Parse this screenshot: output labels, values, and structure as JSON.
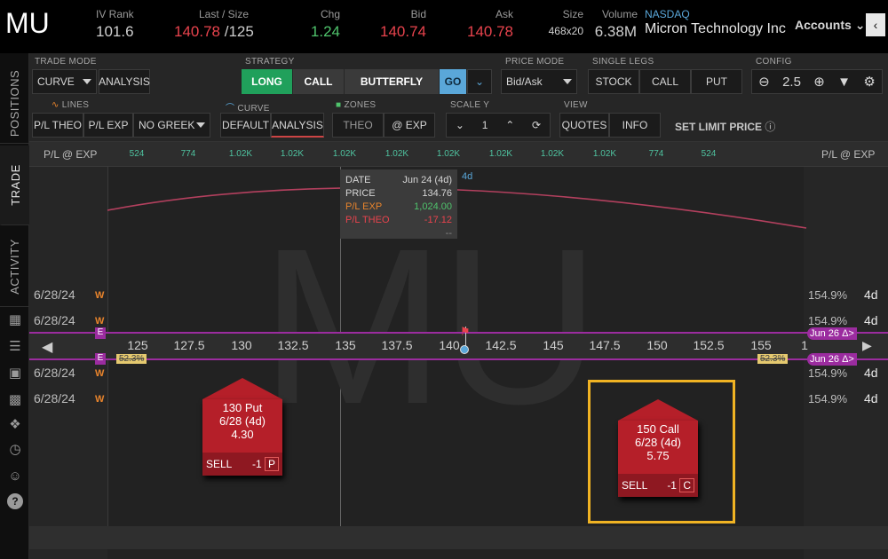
{
  "quote": {
    "symbol": "MU",
    "iv_rank_label": "IV Rank",
    "iv_rank": "101.6",
    "last_label": "Last / Size",
    "last": "140.78",
    "size": "/125",
    "chg_label": "Chg",
    "chg": "1.24",
    "bid_label": "Bid",
    "bid": "140.74",
    "ask_label": "Ask",
    "ask": "140.78",
    "size_label": "Size",
    "size_val": "468x20",
    "volume_label": "Volume",
    "volume": "6.38M",
    "exchange": "NASDAQ",
    "company": "Micron Technology Inc",
    "accounts": "Accounts"
  },
  "sidebar": {
    "positions": "POSITIONS",
    "trade": "TRADE",
    "activity": "ACTIVITY"
  },
  "toolbar": {
    "trade_mode_label": "TRADE MODE",
    "trade_mode": "CURVE",
    "analysis": "ANALYSIS",
    "strategy_label": "STRATEGY",
    "long": "LONG",
    "call": "CALL",
    "butterfly": "BUTTERFLY",
    "go": "GO",
    "price_mode_label": "PRICE MODE",
    "price_mode": "Bid/Ask",
    "single_legs_label": "SINGLE LEGS",
    "stock": "STOCK",
    "leg_call": "CALL",
    "put": "PUT",
    "config_label": "CONFIG",
    "zoom": "2.5",
    "lines_label": "LINES",
    "pl_theo": "P/L THEO",
    "pl_exp": "P/L EXP",
    "no_greek": "NO GREEK",
    "curve_label": "CURVE",
    "default": "DEFAULT",
    "curve_analysis": "ANALYSIS",
    "zones_label": "ZONES",
    "theo": "THEO",
    "at_exp": "@ EXP",
    "scale_y_label": "SCALE Y",
    "scale_y": "1",
    "view_label": "VIEW",
    "quotes": "QUOTES",
    "info": "INFO",
    "set_limit": "SET LIMIT PRICE"
  },
  "header_row": {
    "left_label": "P/L @ EXP",
    "right_label": "P/L @ EXP",
    "values": [
      "524",
      "774",
      "1.02K",
      "1.02K",
      "1.02K",
      "1.02K",
      "1.02K",
      "1.02K",
      "1.02K",
      "1.02K",
      "774",
      "524"
    ]
  },
  "tooltip": {
    "date_label": "DATE",
    "date": "Jun 24 (4d)",
    "price_label": "PRICE",
    "price": "134.76",
    "pl_exp_label": "P/L EXP",
    "pl_exp": "1,024.00",
    "pl_theo_label": "P/L THEO",
    "pl_theo": "-17.12",
    "dash": "--",
    "days_tag": "4d"
  },
  "watermark": "MU",
  "rows": [
    {
      "date": "6/28/24",
      "w": "W",
      "iv": "154.9%",
      "days": "4d"
    },
    {
      "date": "6/28/24",
      "w": "W",
      "iv": "154.9%",
      "days": "4d"
    },
    {
      "date": "6/28/24",
      "w": "W",
      "iv": "154.9%",
      "days": "4d"
    },
    {
      "date": "6/28/24",
      "w": "W",
      "iv": "154.9%",
      "days": "4d"
    }
  ],
  "strikes": [
    "125",
    "127.5",
    "130",
    "132.5",
    "135",
    "137.5",
    "140",
    "142.5",
    "145",
    "147.5",
    "150",
    "152.5",
    "155",
    "1"
  ],
  "exp_markers": {
    "e1": "E",
    "e2": "E",
    "left_pct": "52.3%",
    "right_pct": "52.3%",
    "jun1": "Jun 26 Δ>",
    "jun2": "Jun 26 Δ>"
  },
  "cards": {
    "put": {
      "title": "130 Put",
      "date": "6/28 (4d)",
      "price": "4.30",
      "side": "SELL",
      "qty": "-1",
      "type": "P"
    },
    "call": {
      "title": "150 Call",
      "date": "6/28 (4d)",
      "price": "5.75",
      "side": "SELL",
      "qty": "-1",
      "type": "C"
    }
  },
  "colors": {
    "highlight": "#f0b323",
    "sell": "#b51f29",
    "curve": "#b3405e",
    "marker": "#9b2c9f"
  }
}
